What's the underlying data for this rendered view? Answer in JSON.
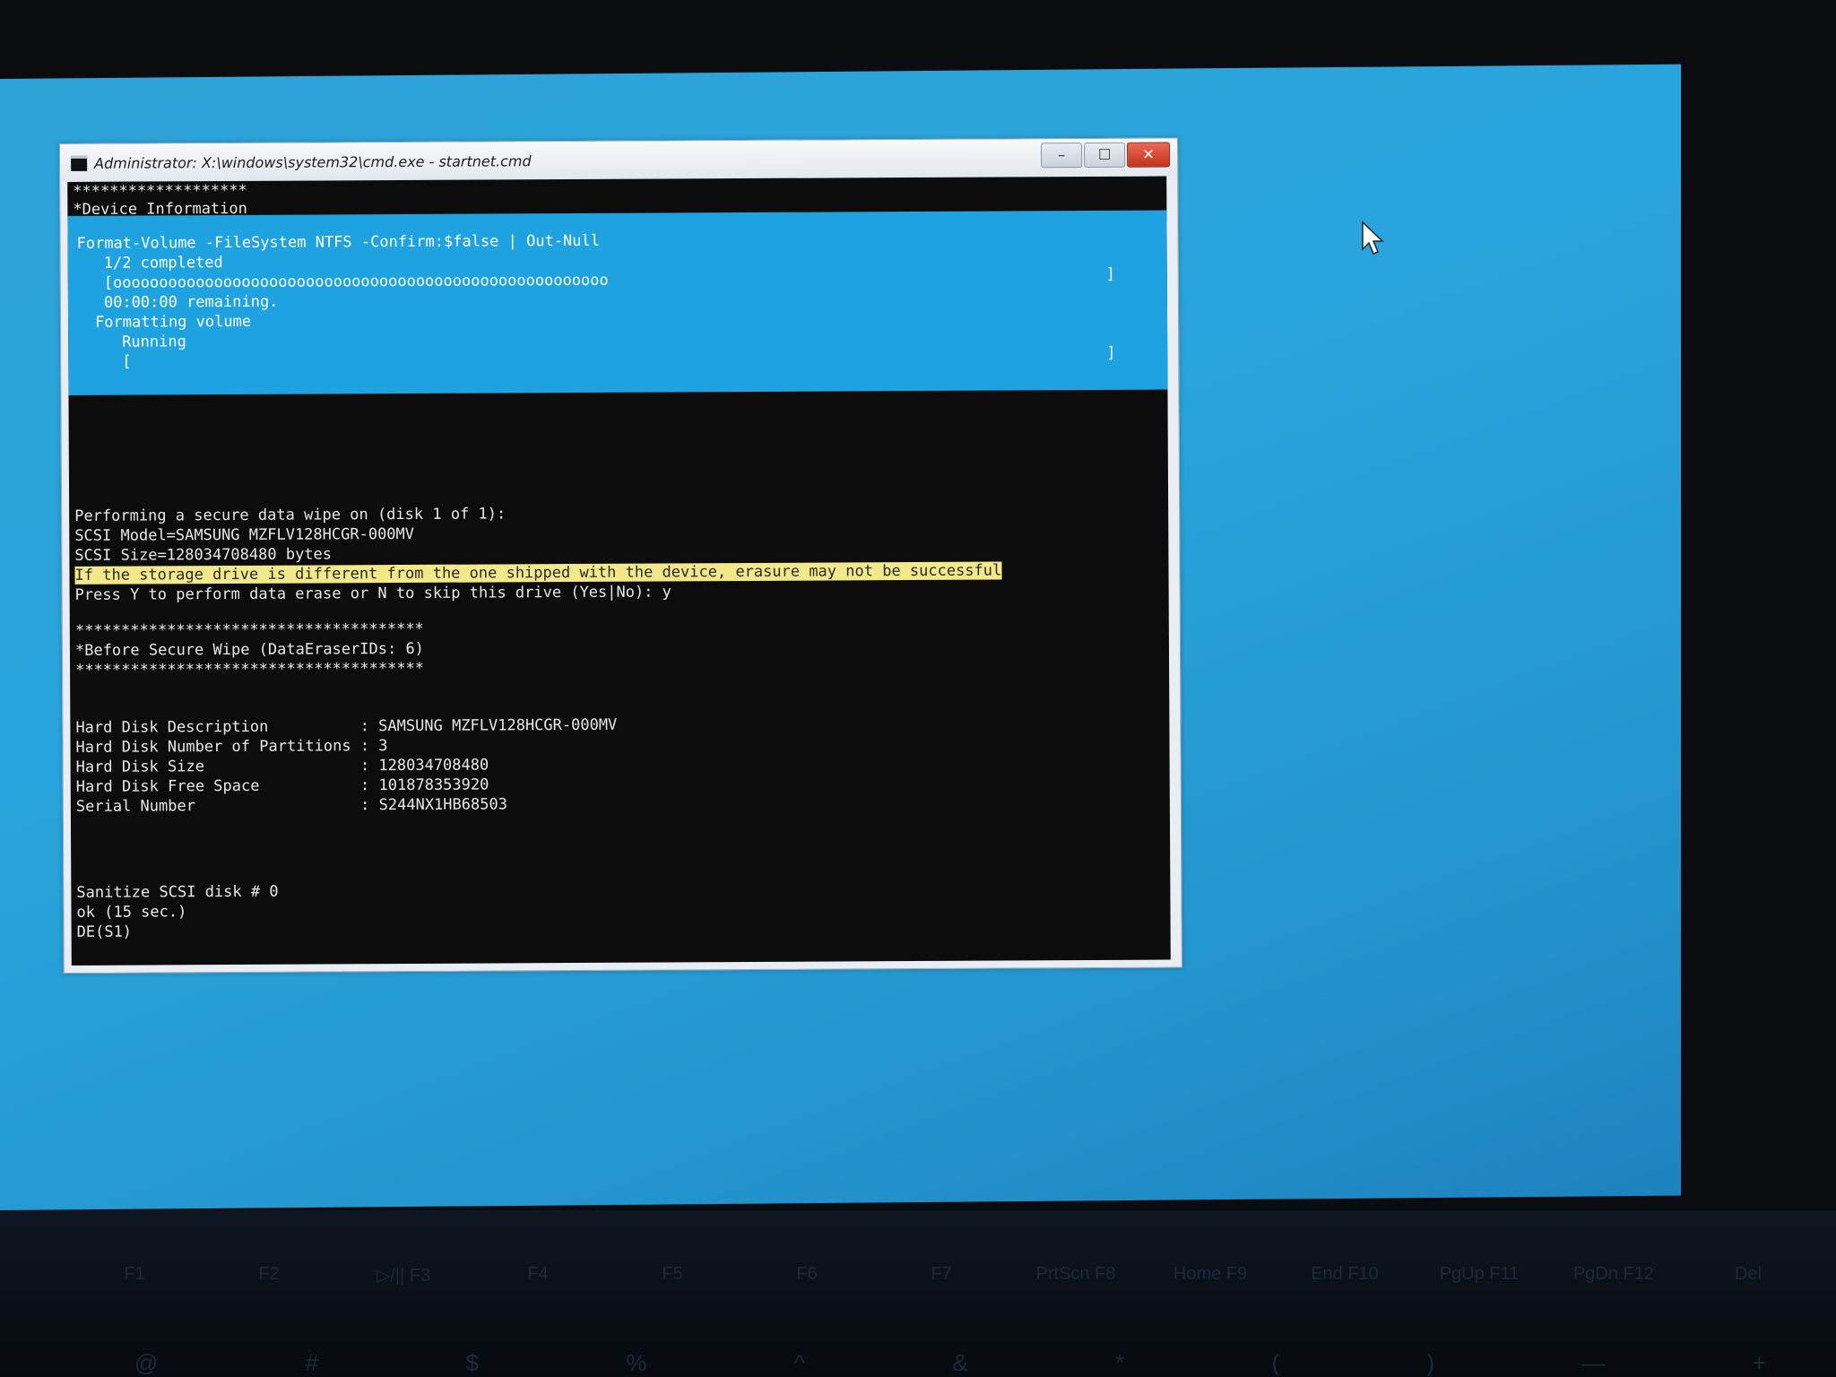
{
  "window": {
    "title": "Administrator: X:\\windows\\system32\\cmd.exe - startnet.cmd",
    "controls": {
      "minimize": "–",
      "maximize": "☐",
      "close": "✕"
    }
  },
  "console": {
    "stars_top": "*******************",
    "device_info": "*Device Information",
    "progress": {
      "command": "Format-Volume -FileSystem NTFS -Confirm:$false | Out-Null",
      "completed": "1/2 completed",
      "bar": "[oooooooooooooooooooooooooooooooooooooooooooooooooooooo",
      "bar_end": "]",
      "remaining": "00:00:00 remaining.",
      "activity": "Formatting volume",
      "status": "Running",
      "bar2": "[",
      "bar2_end": "]"
    },
    "wipe_header": "Performing a secure data wipe on (disk 1 of 1):",
    "scsi_model": "SCSI Model=SAMSUNG MZFLV128HCGR-000MV",
    "scsi_size": "SCSI Size=128034708480 bytes",
    "warning": "If the storage drive is different from the one shipped with the device, erasure may not be successful",
    "prompt": "Press Y to perform data erase or N to skip this drive (Yes|No): y",
    "stars_mid1": "**************************************",
    "before_wipe": "*Before Secure Wipe (DataEraserIDs: 6)",
    "stars_mid2": "**************************************",
    "disk_info": [
      {
        "label": "Hard Disk Description          ",
        "value": ": SAMSUNG MZFLV128HCGR-000MV"
      },
      {
        "label": "Hard Disk Number of Partitions ",
        "value": ": 3"
      },
      {
        "label": "Hard Disk Size                 ",
        "value": ": 128034708480"
      },
      {
        "label": "Hard Disk Free Space           ",
        "value": ": 101878353920"
      },
      {
        "label": "Serial Number                  ",
        "value": ": S244NX1HB68503"
      }
    ],
    "sanitize": "Sanitize SCSI disk # 0",
    "ok": "ok (15 sec.)",
    "de": "DE(S1)"
  },
  "keyboard": {
    "fkeys": [
      "F1",
      "F2",
      "▷/|| F3",
      "F4",
      "F5",
      "F6",
      "F7",
      "PrtScn F8",
      "Home F9",
      "End F10",
      "PgUp F11",
      "PgDn F12",
      "Del"
    ],
    "numrow": [
      "@",
      "#",
      "$",
      "%",
      "^",
      "&",
      "*",
      "(",
      ")",
      "—",
      "+"
    ]
  }
}
